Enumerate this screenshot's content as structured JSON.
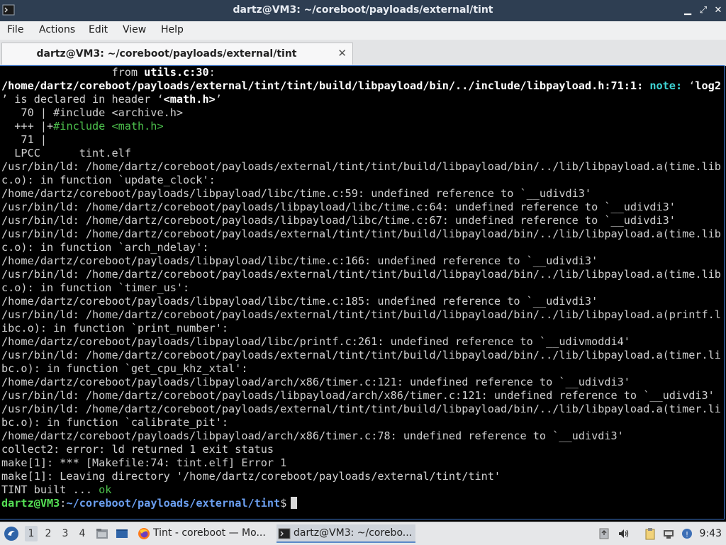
{
  "window": {
    "title": "dartz@VM3: ~/coreboot/payloads/external/tint",
    "minimize_glyph": "▁",
    "maximize_glyph": "⤢",
    "close_glyph": "✕"
  },
  "menu": {
    "file": "File",
    "actions": "Actions",
    "edit": "Edit",
    "view": "View",
    "help": "Help"
  },
  "tab": {
    "label": "dartz@VM3: ~/coreboot/payloads/external/tint",
    "close_glyph": "✕"
  },
  "terminal": {
    "lines": [
      {
        "segments": [
          {
            "t": "                 from "
          },
          {
            "t": "utils.c:30",
            "s": "b"
          },
          {
            "t": ":"
          }
        ]
      },
      {
        "segments": [
          {
            "t": "/home/dartz/coreboot/payloads/external/tint/tint/build/libpayload/bin/../include/libpayload.h:71:1: ",
            "s": "b"
          },
          {
            "t": "note:",
            "s": "note"
          },
          {
            "t": " ‘"
          },
          {
            "t": "log2",
            "s": "b"
          }
        ]
      },
      {
        "segments": [
          {
            "t": "’ is declared in header ‘"
          },
          {
            "t": "<math.h>",
            "s": "b"
          },
          {
            "t": "’"
          }
        ]
      },
      {
        "segments": [
          {
            "t": "   70 | #include <archive.h>"
          }
        ]
      },
      {
        "segments": [
          {
            "t": "  +++ |+"
          },
          {
            "t": "#include <math.h>",
            "s": "grn"
          }
        ]
      },
      {
        "segments": [
          {
            "t": "   71 |"
          }
        ]
      },
      {
        "segments": [
          {
            "t": "  LPCC      tint.elf"
          }
        ]
      },
      {
        "segments": [
          {
            "t": "/usr/bin/ld: /home/dartz/coreboot/payloads/external/tint/tint/build/libpayload/bin/../lib/libpayload.a(time.lib"
          }
        ]
      },
      {
        "segments": [
          {
            "t": "c.o): in function `update_clock':"
          }
        ]
      },
      {
        "segments": [
          {
            "t": "/home/dartz/coreboot/payloads/libpayload/libc/time.c:59: undefined reference to `__udivdi3'"
          }
        ]
      },
      {
        "segments": [
          {
            "t": "/usr/bin/ld: /home/dartz/coreboot/payloads/libpayload/libc/time.c:64: undefined reference to `__udivdi3'"
          }
        ]
      },
      {
        "segments": [
          {
            "t": "/usr/bin/ld: /home/dartz/coreboot/payloads/libpayload/libc/time.c:67: undefined reference to `__udivdi3'"
          }
        ]
      },
      {
        "segments": [
          {
            "t": "/usr/bin/ld: /home/dartz/coreboot/payloads/external/tint/tint/build/libpayload/bin/../lib/libpayload.a(time.lib"
          }
        ]
      },
      {
        "segments": [
          {
            "t": "c.o): in function `arch_ndelay':"
          }
        ]
      },
      {
        "segments": [
          {
            "t": "/home/dartz/coreboot/payloads/libpayload/libc/time.c:166: undefined reference to `__udivdi3'"
          }
        ]
      },
      {
        "segments": [
          {
            "t": "/usr/bin/ld: /home/dartz/coreboot/payloads/external/tint/tint/build/libpayload/bin/../lib/libpayload.a(time.lib"
          }
        ]
      },
      {
        "segments": [
          {
            "t": "c.o): in function `timer_us':"
          }
        ]
      },
      {
        "segments": [
          {
            "t": "/home/dartz/coreboot/payloads/libpayload/libc/time.c:185: undefined reference to `__udivdi3'"
          }
        ]
      },
      {
        "segments": [
          {
            "t": "/usr/bin/ld: /home/dartz/coreboot/payloads/external/tint/tint/build/libpayload/bin/../lib/libpayload.a(printf.l"
          }
        ]
      },
      {
        "segments": [
          {
            "t": "ibc.o): in function `print_number':"
          }
        ]
      },
      {
        "segments": [
          {
            "t": "/home/dartz/coreboot/payloads/libpayload/libc/printf.c:261: undefined reference to `__udivmoddi4'"
          }
        ]
      },
      {
        "segments": [
          {
            "t": "/usr/bin/ld: /home/dartz/coreboot/payloads/external/tint/tint/build/libpayload/bin/../lib/libpayload.a(timer.li"
          }
        ]
      },
      {
        "segments": [
          {
            "t": "bc.o): in function `get_cpu_khz_xtal':"
          }
        ]
      },
      {
        "segments": [
          {
            "t": "/home/dartz/coreboot/payloads/libpayload/arch/x86/timer.c:121: undefined reference to `__udivdi3'"
          }
        ]
      },
      {
        "segments": [
          {
            "t": "/usr/bin/ld: /home/dartz/coreboot/payloads/libpayload/arch/x86/timer.c:121: undefined reference to `__udivdi3'"
          }
        ]
      },
      {
        "segments": [
          {
            "t": "/usr/bin/ld: /home/dartz/coreboot/payloads/external/tint/tint/build/libpayload/bin/../lib/libpayload.a(timer.li"
          }
        ]
      },
      {
        "segments": [
          {
            "t": "bc.o): in function `calibrate_pit':"
          }
        ]
      },
      {
        "segments": [
          {
            "t": "/home/dartz/coreboot/payloads/libpayload/arch/x86/timer.c:78: undefined reference to `__udivdi3'"
          }
        ]
      },
      {
        "segments": [
          {
            "t": "collect2: error: ld returned 1 exit status"
          }
        ]
      },
      {
        "segments": [
          {
            "t": "make[1]: *** [Makefile:74: tint.elf] Error 1"
          }
        ]
      },
      {
        "segments": [
          {
            "t": "make[1]: Leaving directory '/home/dartz/coreboot/payloads/external/tint/tint'"
          }
        ]
      },
      {
        "segments": [
          {
            "t": "TINT built ... "
          },
          {
            "t": "ok",
            "s": "grn"
          }
        ]
      }
    ],
    "prompt": {
      "user": "dartz@VM3",
      "sep": ":",
      "path": "~/coreboot/payloads/external/tint",
      "symbol": "$"
    }
  },
  "taskbar": {
    "workspaces": [
      "1",
      "2",
      "3",
      "4"
    ],
    "tasks": [
      {
        "label": "Tint - coreboot — Mo...",
        "icon": "firefox-icon"
      },
      {
        "label": "dartz@VM3: ~/corebo...",
        "icon": "terminal-icon"
      }
    ],
    "clock": "9:43",
    "colors": {
      "accent": "#5a88c8",
      "titlebar": "#2e3e52"
    }
  }
}
